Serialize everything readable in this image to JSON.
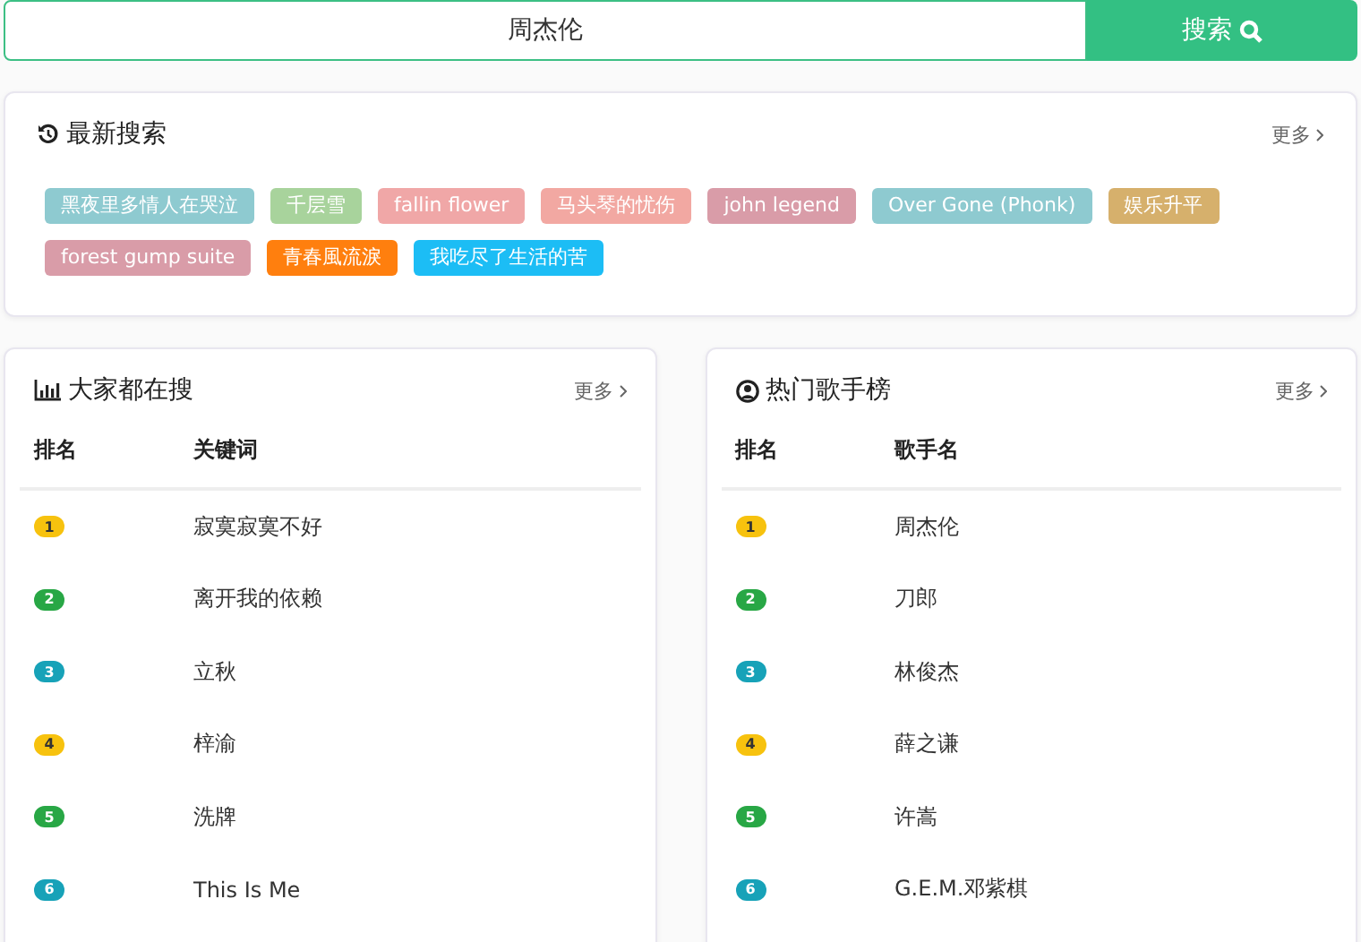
{
  "search": {
    "value": "周杰伦",
    "button": "搜索"
  },
  "recent": {
    "title": "最新搜索",
    "more": "更多",
    "tags": [
      {
        "label": "黑夜里多情人在哭泣",
        "color": "#8ecad0"
      },
      {
        "label": "千层雪",
        "color": "#a8d39c"
      },
      {
        "label": "fallin flower",
        "color": "#f0a7a7"
      },
      {
        "label": "马头琴的忧伤",
        "color": "#f2a8a2"
      },
      {
        "label": "john legend",
        "color": "#d99ca8"
      },
      {
        "label": "Over Gone (Phonk)",
        "color": "#8ecad0"
      },
      {
        "label": "娱乐升平",
        "color": "#d6b06c"
      },
      {
        "label": "forest gump suite",
        "color": "#d99ca8"
      },
      {
        "label": "青春風流淚",
        "color": "#ff7f0e"
      },
      {
        "label": "我吃尽了生活的苦",
        "color": "#1cbdf5"
      }
    ]
  },
  "panels": [
    {
      "kind": "chart",
      "title": "大家都在搜",
      "more": "更多",
      "columns": [
        "排名",
        "关键词"
      ],
      "rows": [
        {
          "rank": "1",
          "color": "#f7c20e",
          "name": "寂寞寂寞不好"
        },
        {
          "rank": "2",
          "color": "#28a745",
          "name": "离开我的依赖"
        },
        {
          "rank": "3",
          "color": "#17a2b8",
          "name": "立秋"
        },
        {
          "rank": "4",
          "color": "#f7c20e",
          "name": "梓渝"
        },
        {
          "rank": "5",
          "color": "#28a745",
          "name": "洗牌"
        },
        {
          "rank": "6",
          "color": "#17a2b8",
          "name": "This Is Me"
        }
      ]
    },
    {
      "kind": "user",
      "title": "热门歌手榜",
      "more": "更多",
      "columns": [
        "排名",
        "歌手名"
      ],
      "rows": [
        {
          "rank": "1",
          "color": "#f7c20e",
          "name": "周杰伦"
        },
        {
          "rank": "2",
          "color": "#28a745",
          "name": "刀郎"
        },
        {
          "rank": "3",
          "color": "#17a2b8",
          "name": "林俊杰"
        },
        {
          "rank": "4",
          "color": "#f7c20e",
          "name": "薛之谦"
        },
        {
          "rank": "5",
          "color": "#28a745",
          "name": "许嵩"
        },
        {
          "rank": "6",
          "color": "#17a2b8",
          "name": "G.E.M.邓紫棋"
        }
      ]
    }
  ]
}
